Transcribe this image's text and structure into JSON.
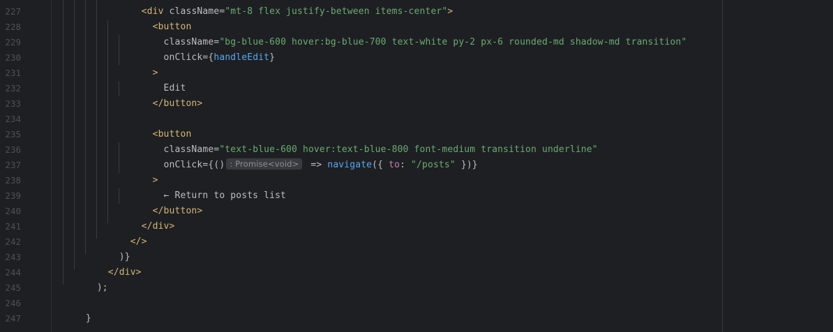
{
  "editor": {
    "line_numbers": [
      "227",
      "228",
      "229",
      "230",
      "231",
      "232",
      "233",
      "234",
      "235",
      "236",
      "237",
      "238",
      "239",
      "240",
      "241",
      "242",
      "243",
      "244",
      "245",
      "246",
      "247"
    ],
    "lines": {
      "l227": {
        "indent": "                ",
        "open": "<div ",
        "attr": "className",
        "eq": "=",
        "value": "\"mt-8 flex justify-between items-center\"",
        "close": ">"
      },
      "l228": {
        "indent": "                  ",
        "tag": "<button"
      },
      "l229": {
        "indent": "                    ",
        "attr": "className",
        "eq": "=",
        "value": "\"bg-blue-600 hover:bg-blue-700 text-white py-2 px-6 rounded-md shadow-md transition\""
      },
      "l230": {
        "indent": "                    ",
        "attr": "onClick",
        "eq": "={",
        "fn": "handleEdit",
        "close": "}"
      },
      "l231": {
        "indent": "                  ",
        "tag": ">"
      },
      "l232": {
        "indent": "                    ",
        "text": "Edit"
      },
      "l233": {
        "indent": "                  ",
        "tag": "</button>"
      },
      "l234": {
        "text": ""
      },
      "l235": {
        "indent": "                  ",
        "tag": "<button"
      },
      "l236": {
        "indent": "                    ",
        "attr": "className",
        "eq": "=",
        "value": "\"text-blue-600 hover:text-blue-800 font-medium transition underline\""
      },
      "l237": {
        "indent": "                    ",
        "attr": "onClick",
        "eq": "={()",
        "hint": ": Promise<void>",
        "arrow": " => ",
        "fn": "navigate",
        "paren_open": "({ ",
        "key": "to",
        "colon": ": ",
        "value": "\"/posts\"",
        "close": " })}"
      },
      "l238": {
        "indent": "                  ",
        "tag": ">"
      },
      "l239": {
        "indent": "                    ",
        "text": "← Return to posts list"
      },
      "l240": {
        "indent": "                  ",
        "tag": "</button>"
      },
      "l241": {
        "indent": "                ",
        "tag": "</div>"
      },
      "l242": {
        "indent": "              ",
        "tag": "</>"
      },
      "l243": {
        "indent": "            ",
        "text": ")}"
      },
      "l244": {
        "indent": "          ",
        "tag": "</div>"
      },
      "l245": {
        "indent": "        ",
        "text": ");"
      },
      "l246": {
        "text": ""
      },
      "l247": {
        "indent": "      ",
        "text": "}"
      }
    }
  },
  "colors": {
    "background": "#1e1f22",
    "line_number": "#4b5059",
    "tag": "#d5b778",
    "string": "#6aab73",
    "function": "#56a8f5",
    "keyword_property": "#c77dbb",
    "default_text": "#bcbec4",
    "inlay_hint_bg": "#393b40"
  }
}
